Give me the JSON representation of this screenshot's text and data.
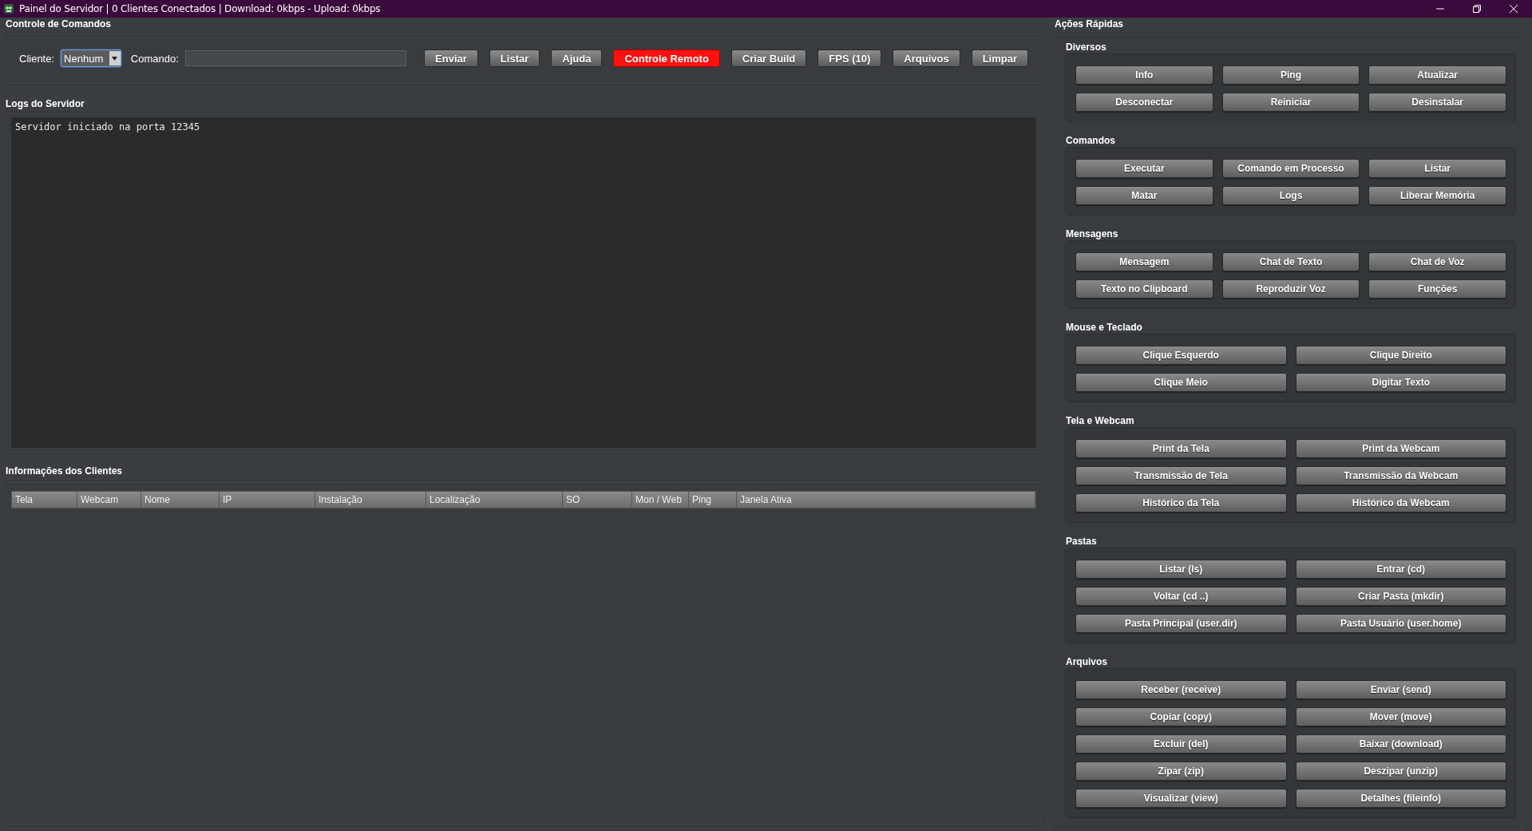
{
  "window": {
    "title": "Painel do Servidor | 0 Clientes Conectados | Download: 0kbps - Upload: 0kbps"
  },
  "command_panel": {
    "title": "Controle de Comandos",
    "client_label": "Cliente:",
    "client_value": "Nenhum",
    "command_label": "Comando:",
    "buttons": [
      {
        "label": "Enviar",
        "kind": "normal"
      },
      {
        "label": "Listar",
        "kind": "normal"
      },
      {
        "label": "Ajuda",
        "kind": "normal"
      },
      {
        "label": "Controle Remoto",
        "kind": "danger"
      },
      {
        "label": "Criar Build",
        "kind": "normal"
      },
      {
        "label": "FPS (10)",
        "kind": "normal"
      },
      {
        "label": "Arquivos",
        "kind": "normal"
      },
      {
        "label": "Limpar",
        "kind": "normal"
      }
    ]
  },
  "logs": {
    "title": "Logs do Servidor",
    "lines": [
      "Servidor iniciado na porta 12345"
    ]
  },
  "clients": {
    "title": "Informações dos Clientes",
    "columns": [
      "Tela",
      "Webcam",
      "Nome",
      "IP",
      "Instalação",
      "Localização",
      "SO",
      "Mon / Web",
      "Ping",
      "Janela Ativa"
    ]
  },
  "quick_actions": {
    "title": "Ações Rápidas",
    "groups": [
      {
        "title": "Diversos",
        "rows": [
          [
            "Info",
            "Ping",
            "Atualizar"
          ],
          [
            "Desconectar",
            "Reiniciar",
            "Desinstalar"
          ]
        ]
      },
      {
        "title": "Comandos",
        "rows": [
          [
            "Executar",
            "Comando em Processo",
            "Listar"
          ],
          [
            "Matar",
            "Logs",
            "Liberar Memória"
          ]
        ]
      },
      {
        "title": "Mensagens",
        "rows": [
          [
            "Mensagem",
            "Chat de Texto",
            "Chat de Voz"
          ],
          [
            "Texto no Clipboard",
            "Reproduzir Voz",
            "Funções"
          ]
        ]
      },
      {
        "title": "Mouse e Teclado",
        "rows": [
          [
            "Clique Esquerdo",
            "Clique Direito"
          ],
          [
            "Clique Meio",
            "Digitar Texto"
          ]
        ]
      },
      {
        "title": "Tela e Webcam",
        "rows": [
          [
            "Print da Tela",
            "Print da Webcam"
          ],
          [
            "Transmissão de Tela",
            "Transmissão da Webcam"
          ],
          [
            "Histórico da Tela",
            "Histórico da Webcam"
          ]
        ]
      },
      {
        "title": "Pastas",
        "rows": [
          [
            "Listar (ls)",
            "Entrar (cd)"
          ],
          [
            "Voltar (cd ..)",
            "Criar Pasta (mkdir)"
          ],
          [
            "Pasta Principal (user.dir)",
            "Pasta Usuário (user.home)"
          ]
        ]
      },
      {
        "title": "Arquivos",
        "rows": [
          [
            "Receber (receive)",
            "Enviar (send)"
          ],
          [
            "Copiar (copy)",
            "Mover (move)"
          ],
          [
            "Excluir (del)",
            "Baixar (download)"
          ],
          [
            "Zipar (zip)",
            "Deszipar (unzip)"
          ],
          [
            "Visualizar (view)",
            "Detalhes (fileinfo)"
          ]
        ]
      }
    ]
  }
}
